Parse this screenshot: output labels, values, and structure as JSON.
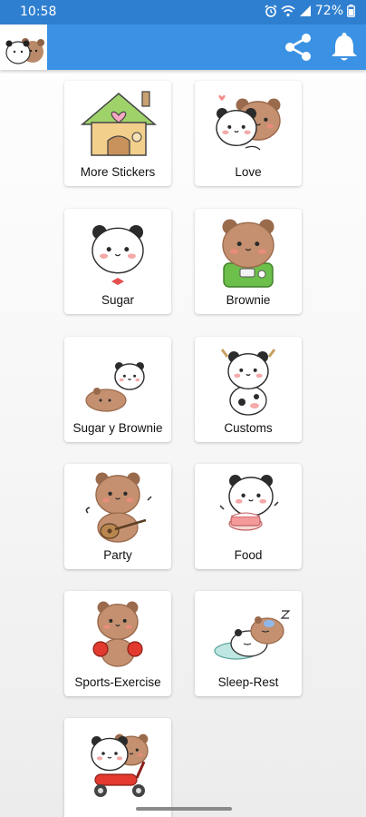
{
  "status_bar": {
    "time": "10:58",
    "battery": "72%",
    "icons": [
      "alarm-icon",
      "wifi-icon",
      "signal-icon",
      "battery-icon"
    ]
  },
  "app_bar": {
    "logo_icon": "panda-bear-logo",
    "actions": [
      "share-icon",
      "bell-icon"
    ],
    "color": "#3b92e4"
  },
  "grid": {
    "items": [
      {
        "label": "More Stickers",
        "icon": "house-icon"
      },
      {
        "label": "Love",
        "icon": "hug-icon"
      },
      {
        "label": "Sugar",
        "icon": "panda-icon"
      },
      {
        "label": "Brownie",
        "icon": "bear-icon"
      },
      {
        "label": "Sugar y Brownie",
        "icon": "pair-icon"
      },
      {
        "label": "Customs",
        "icon": "cow-costume-icon"
      },
      {
        "label": "Party",
        "icon": "guitar-bear-icon"
      },
      {
        "label": "Food",
        "icon": "cake-panda-icon"
      },
      {
        "label": "Sports-Exercise",
        "icon": "boxing-bear-icon"
      },
      {
        "label": "Sleep-Rest",
        "icon": "sleeping-pair-icon"
      },
      {
        "label": "",
        "icon": "scooter-pair-icon"
      }
    ]
  }
}
